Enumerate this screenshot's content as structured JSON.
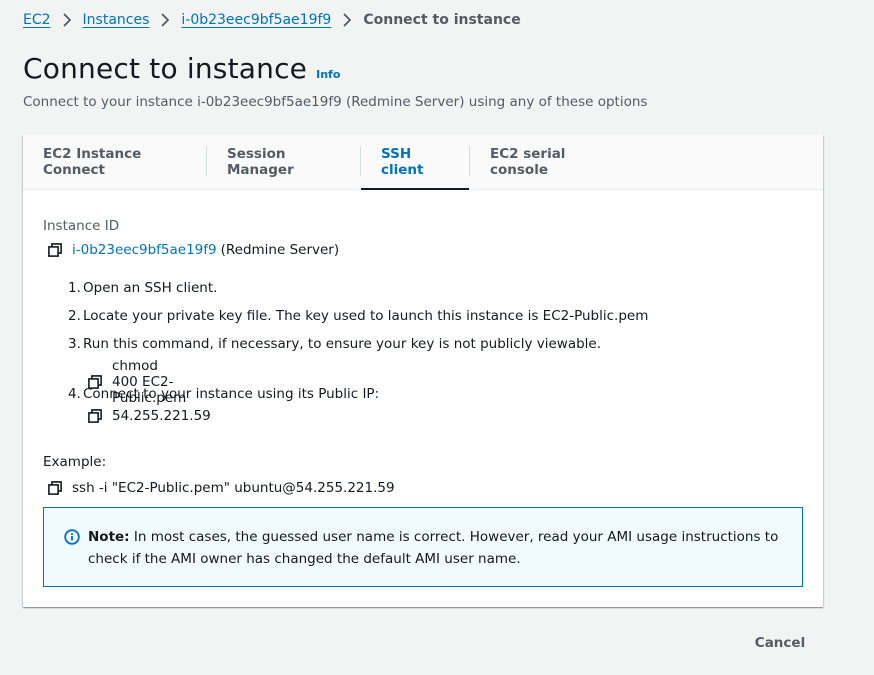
{
  "breadcrumb": {
    "items": [
      "EC2",
      "Instances",
      "i-0b23eec9bf5ae19f9"
    ],
    "current": "Connect to instance"
  },
  "page": {
    "title": "Connect to instance",
    "info_label": "Info",
    "subtitle": "Connect to your instance i-0b23eec9bf5ae19f9 (Redmine Server) using any of these options"
  },
  "tabs": [
    {
      "label": "EC2 Instance Connect",
      "active": false
    },
    {
      "label": "Session Manager",
      "active": false
    },
    {
      "label": "SSH client",
      "active": true
    },
    {
      "label": "EC2 serial console",
      "active": false
    }
  ],
  "instance": {
    "label": "Instance ID",
    "id": "i-0b23eec9bf5ae19f9",
    "name": "(Redmine Server)"
  },
  "steps": [
    {
      "num": "1.",
      "text": "Open an SSH client."
    },
    {
      "num": "2.",
      "text": "Locate your private key file. The key used to launch this instance is EC2-Public.pem"
    },
    {
      "num": "3.",
      "text": "Run this command, if necessary, to ensure your key is not publicly viewable.",
      "code": "chmod 400 EC2-Public.pem"
    },
    {
      "num": "4.",
      "text": "Connect to your instance using its Public IP:",
      "code": "54.255.221.59"
    }
  ],
  "example": {
    "label": "Example:",
    "command": "ssh -i \"EC2-Public.pem\" ubuntu@54.255.221.59"
  },
  "alert": {
    "bold": "Note:",
    "text": " In most cases, the guessed user name is correct. However, read your AMI usage instructions to check if the AMI owner has changed the default AMI user name."
  },
  "footer": {
    "cancel_label": "Cancel"
  },
  "colors": {
    "link": "#0073bb",
    "background": "#f2f3f3",
    "alert_bg": "#f1faff",
    "active_tab_underline": "#16191f"
  }
}
